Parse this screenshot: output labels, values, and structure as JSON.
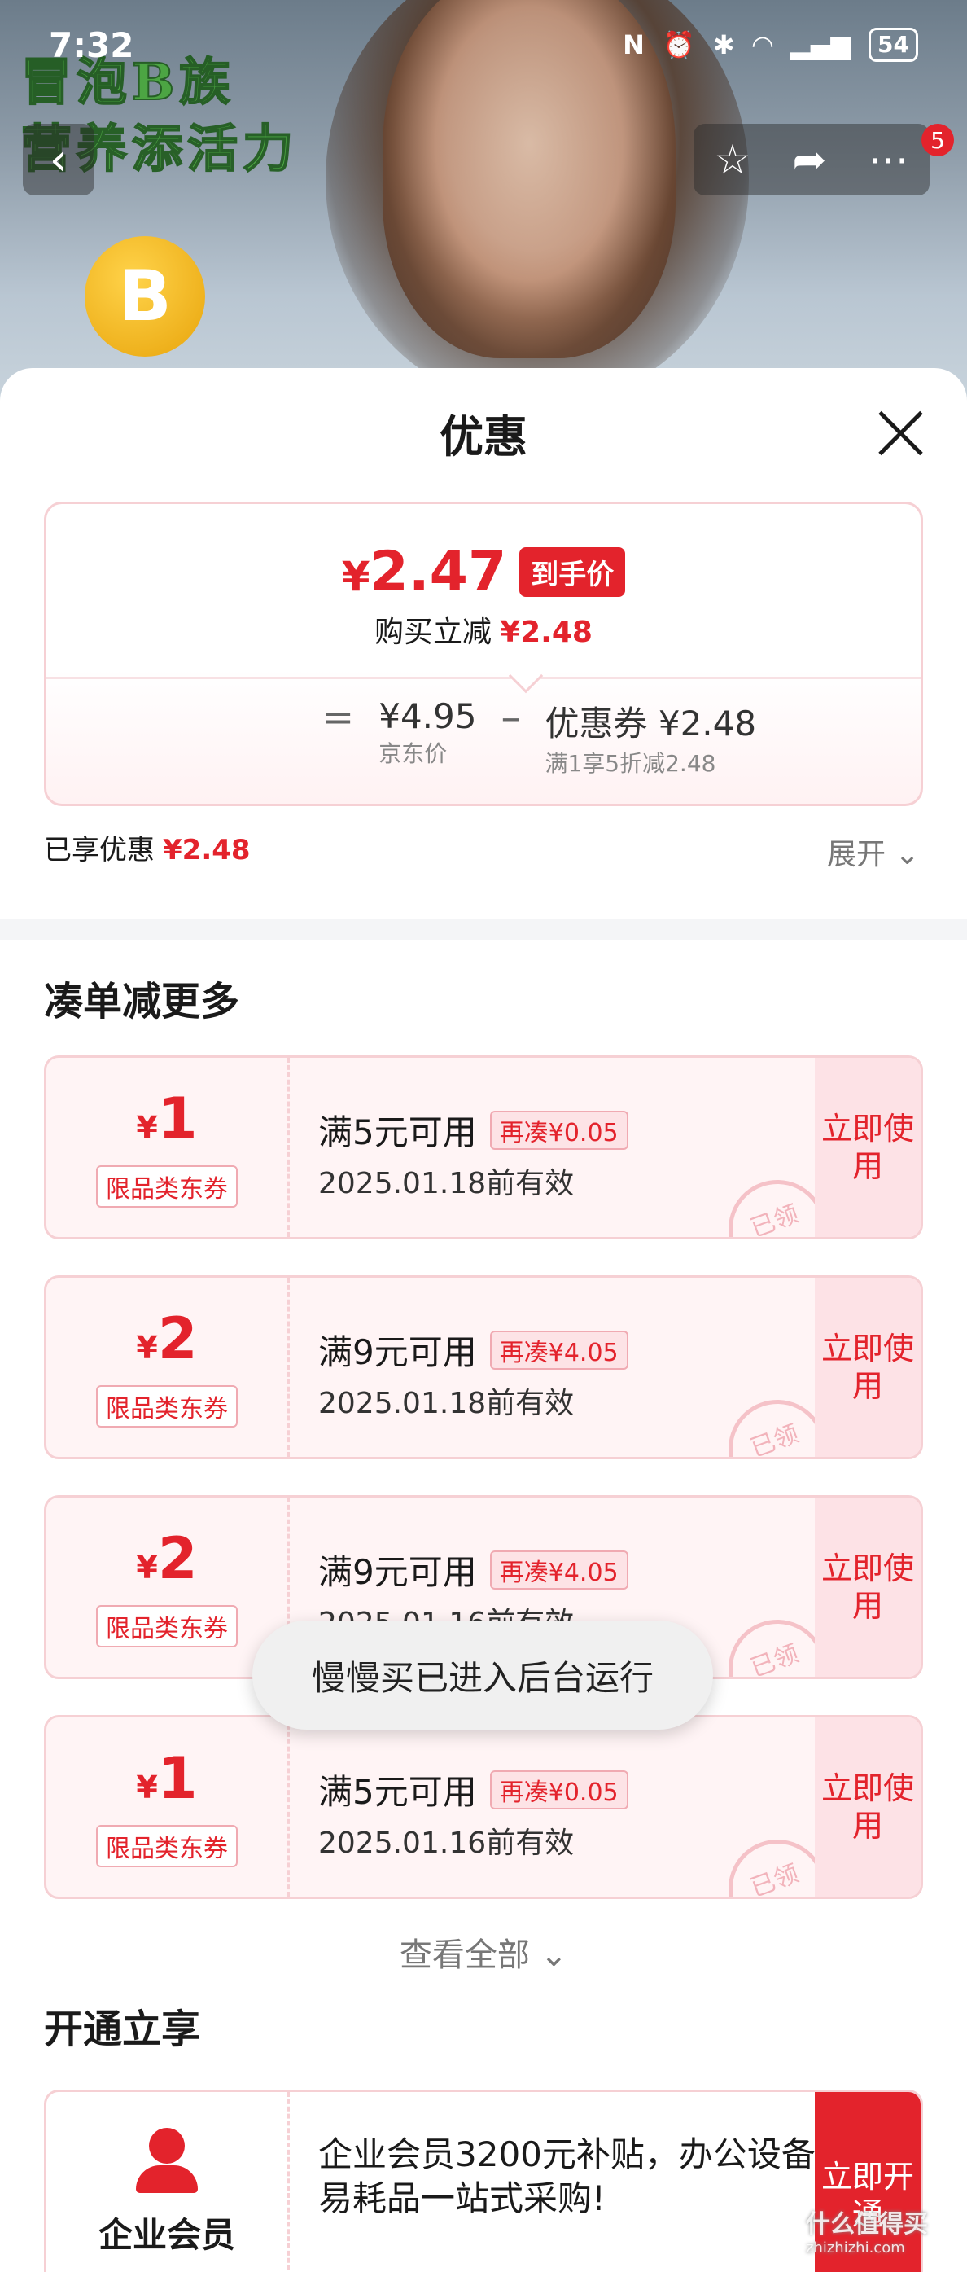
{
  "status_bar": {
    "time": "7:32",
    "nfc": "N",
    "battery": "54"
  },
  "hero": {
    "slogan_line1": "冒泡B族",
    "slogan_line2": "营养添活力",
    "logo_letter": "B"
  },
  "nav": {
    "back_icon": "chevron-left-icon",
    "star_icon": "star-icon",
    "share_icon": "share-icon",
    "more_icon": "more-icon",
    "badge_count": "5"
  },
  "sheet": {
    "title": "优惠",
    "close_icon": "close-icon"
  },
  "price": {
    "amount": "2.47",
    "currency": "¥",
    "tag": "到手价",
    "reduce_label": "购买立减",
    "reduce_value": "¥2.48",
    "equals": "=",
    "jd_price": "¥4.95",
    "jd_price_label": "京东价",
    "minus": "–",
    "coupon_label": "优惠券",
    "coupon_value": "¥2.48",
    "coupon_rule": "满1享5折减2.48"
  },
  "enjoyed": {
    "label": "已享优惠",
    "value": "¥2.48",
    "expand": "展开"
  },
  "combine_section": {
    "title": "凑单减更多",
    "coupons": [
      {
        "currency": "¥",
        "amount": "1",
        "category": "限品类东券",
        "condition": "满5元可用",
        "more": "再凑¥0.05",
        "valid": "2025.01.18前有效",
        "action": "立即使用",
        "stamp": "已领"
      },
      {
        "currency": "¥",
        "amount": "2",
        "category": "限品类东券",
        "condition": "满9元可用",
        "more": "再凑¥4.05",
        "valid": "2025.01.18前有效",
        "action": "立即使用",
        "stamp": "已领"
      },
      {
        "currency": "¥",
        "amount": "2",
        "category": "限品类东券",
        "condition": "满9元可用",
        "more": "再凑¥4.05",
        "valid": "2025.01.16前有效",
        "action": "立即使用",
        "stamp": "已领"
      },
      {
        "currency": "¥",
        "amount": "1",
        "category": "限品类东券",
        "condition": "满5元可用",
        "more": "再凑¥0.05",
        "valid": "2025.01.16前有效",
        "action": "立即使用",
        "stamp": "已领"
      }
    ],
    "view_all": "查看全部"
  },
  "open_section": {
    "title": "开通立享",
    "member_name": "企业会员",
    "member_desc": "企业会员3200元补贴，办公设备/易耗品一站式采购!",
    "action": "立即开通"
  },
  "toast": "慢慢买已进入后台运行",
  "watermark": {
    "text": "什么值得买",
    "sub": "zhizhizhi.com"
  },
  "colors": {
    "accent": "#e3232c",
    "coupon_bg": "#fff4f5",
    "border": "#f6d0d4"
  }
}
